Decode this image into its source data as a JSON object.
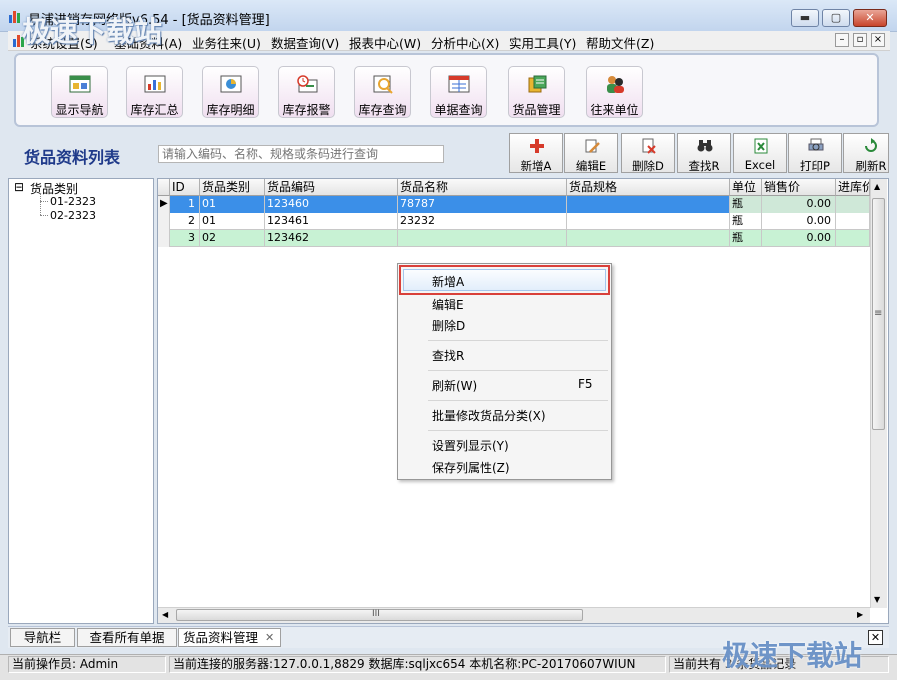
{
  "window": {
    "title": "易浦进销存网络版v6.54 - [货品资料管理]",
    "watermark": "极速下载站"
  },
  "menu": [
    "系统设置(S)",
    "基础资料(A)",
    "业务往来(U)",
    "数据查询(V)",
    "报表中心(W)",
    "分析中心(X)",
    "实用工具(Y)",
    "帮助文件(Z)"
  ],
  "toolbar": [
    {
      "label": "显示导航",
      "icon": "navigation-icon"
    },
    {
      "label": "库存汇总",
      "icon": "inventory-summary-icon"
    },
    {
      "label": "库存明细",
      "icon": "inventory-detail-icon"
    },
    {
      "label": "库存报警",
      "icon": "inventory-alarm-icon"
    },
    {
      "label": "库存查询",
      "icon": "inventory-query-icon"
    },
    {
      "label": "单据查询",
      "icon": "document-query-icon"
    },
    {
      "label": "货品管理",
      "icon": "goods-management-icon"
    },
    {
      "label": "往来单位",
      "icon": "partners-icon"
    }
  ],
  "page": {
    "title": "货品资料列表",
    "search_placeholder": "请输入编码、名称、规格或条码进行查询"
  },
  "actions": [
    {
      "label": "新增A",
      "icon": "add-icon"
    },
    {
      "label": "编辑E",
      "icon": "edit-icon"
    },
    {
      "label": "删除D",
      "icon": "delete-icon"
    },
    {
      "label": "查找R",
      "icon": "binoculars-icon"
    },
    {
      "label": "Excel",
      "icon": "excel-icon"
    },
    {
      "label": "打印P",
      "icon": "print-icon"
    },
    {
      "label": "刷新R",
      "icon": "refresh-icon"
    }
  ],
  "tree": {
    "root": "货品类别",
    "toggle": "⊟",
    "children": [
      "01-2323",
      "02-2323"
    ]
  },
  "grid": {
    "columns": [
      "ID",
      "货品类别",
      "货品编码",
      "货品名称",
      "货品规格",
      "单位",
      "销售价",
      "进库价"
    ],
    "rows": [
      {
        "id": "1",
        "category": "01",
        "code": "123460",
        "name": "78787",
        "spec": "",
        "unit": "瓶",
        "price": "0.00"
      },
      {
        "id": "2",
        "category": "01",
        "code": "123461",
        "name": "23232",
        "spec": "",
        "unit": "瓶",
        "price": "0.00"
      },
      {
        "id": "3",
        "category": "02",
        "code": "123462",
        "name": "",
        "spec": "",
        "unit": "瓶",
        "price": "0.00"
      }
    ],
    "hscroll_grip": "III",
    "vscroll_grip": "≡"
  },
  "context_menu": {
    "items": [
      {
        "label": "新增A",
        "shortcut": ""
      },
      {
        "label": "编辑E",
        "shortcut": ""
      },
      {
        "label": "删除D",
        "shortcut": ""
      },
      {
        "label": "查找R",
        "shortcut": ""
      },
      {
        "label": "刷新(W)",
        "shortcut": "F5"
      },
      {
        "label": "批量修改货品分类(X)",
        "shortcut": ""
      },
      {
        "label": "设置列显示(Y)",
        "shortcut": ""
      },
      {
        "label": "保存列属性(Z)",
        "shortcut": ""
      }
    ]
  },
  "tabs": [
    "导航栏",
    "查看所有单据",
    "货品资料管理"
  ],
  "status": {
    "operator": "当前操作员: Admin",
    "server": "当前连接的服务器:127.0.0.1,8829 数据库:sqljxc654 本机名称:PC-20170607WIUN",
    "count": "当前共有 3 条货品记录"
  }
}
